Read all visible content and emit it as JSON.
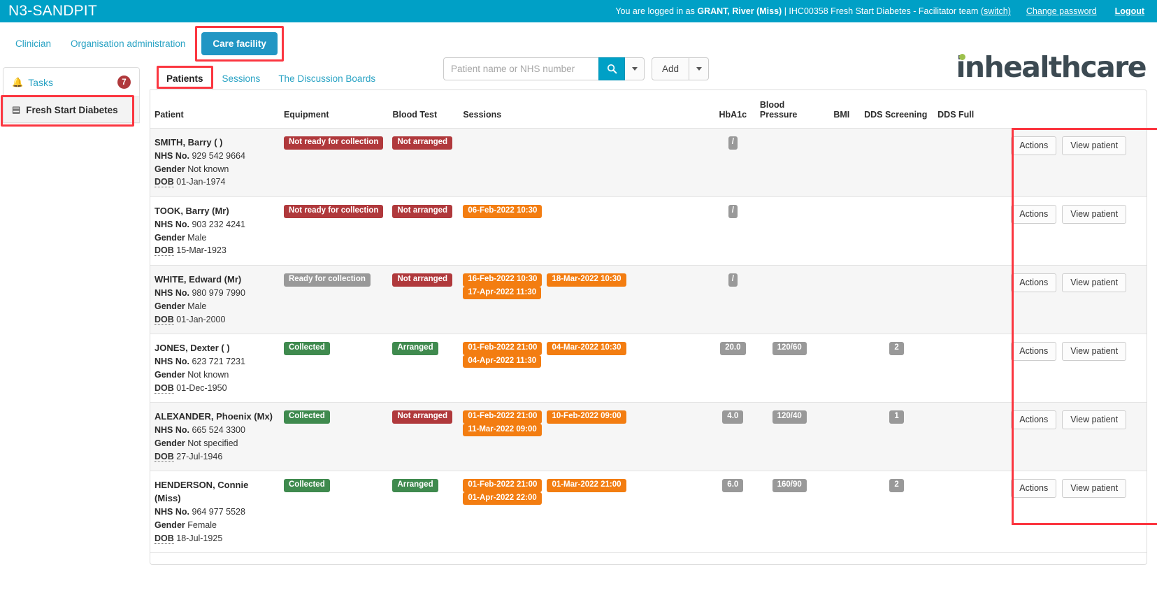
{
  "topbar": {
    "brand": "N3-SANDPIT",
    "logged_in_prefix": "You are logged in as ",
    "user_name": "GRANT, River (Miss)",
    "org_info": " | IHC00358 Fresh Start Diabetes - Facilitator team ",
    "switch_label": "(switch)",
    "change_password": "Change password",
    "logout": "Logout",
    "accent_color": "#00a0c6"
  },
  "nav": {
    "tabs": [
      {
        "label": "Clinician",
        "selected": false
      },
      {
        "label": "Organisation administration",
        "selected": false
      },
      {
        "label": "Care facility",
        "selected": true
      }
    ],
    "selected_color": "#2196c4",
    "highlight_color": "#fb3640"
  },
  "search": {
    "placeholder": "Patient name or NHS number",
    "value": "",
    "search_icon": "search-icon",
    "dropdown_icon": "chevron-down-icon",
    "add_label": "Add"
  },
  "logo": {
    "text": "inhealthcare",
    "dot_color": "#9cc04b",
    "text_color": "#3c4a52"
  },
  "sidebar": {
    "tasks": {
      "label": "Tasks",
      "icon": "bell-icon",
      "badge": "7",
      "badge_color": "#b0393c"
    },
    "items": [
      {
        "label": "Fresh Start Diabetes",
        "icon": "list-icon",
        "selected": true
      }
    ]
  },
  "subtabs": [
    {
      "label": "Patients",
      "selected": true
    },
    {
      "label": "Sessions",
      "selected": false
    },
    {
      "label": "The Discussion Boards",
      "selected": false
    }
  ],
  "table": {
    "columns": [
      "Patient",
      "Equipment",
      "Blood Test",
      "Sessions",
      "HbA1c",
      "Blood Pressure",
      "BMI",
      "DDS Screening",
      "DDS Full",
      ""
    ],
    "actions_label": "Actions",
    "view_label": "View patient",
    "rows": [
      {
        "name": "SMITH, Barry ( )",
        "nhs_label": "NHS No.",
        "nhs": "929 542 9664",
        "gender_label": "Gender",
        "gender": "Not known",
        "dob_label": "DOB",
        "dob": "01-Jan-1974",
        "equipment": {
          "text": "Not ready for collection",
          "color": "red"
        },
        "blood_test": {
          "text": "Not arranged",
          "color": "red"
        },
        "sessions": [],
        "hba1c": {
          "text": "/",
          "color": "grey"
        },
        "bp": null,
        "bmi": null,
        "dds_screening": null,
        "dds_full": null
      },
      {
        "name": "TOOK, Barry (Mr)",
        "nhs_label": "NHS No.",
        "nhs": "903 232 4241",
        "gender_label": "Gender",
        "gender": "Male",
        "dob_label": "DOB",
        "dob": "15-Mar-1923",
        "equipment": {
          "text": "Not ready for collection",
          "color": "red"
        },
        "blood_test": {
          "text": "Not arranged",
          "color": "red"
        },
        "sessions": [
          {
            "text": "06-Feb-2022 10:30",
            "color": "orange"
          }
        ],
        "hba1c": {
          "text": "/",
          "color": "grey"
        },
        "bp": null,
        "bmi": null,
        "dds_screening": null,
        "dds_full": null
      },
      {
        "name": "WHITE, Edward (Mr)",
        "nhs_label": "NHS No.",
        "nhs": "980 979 7990",
        "gender_label": "Gender",
        "gender": "Male",
        "dob_label": "DOB",
        "dob": "01-Jan-2000",
        "equipment": {
          "text": "Ready for collection",
          "color": "grey"
        },
        "blood_test": {
          "text": "Not arranged",
          "color": "red"
        },
        "sessions": [
          {
            "text": "16-Feb-2022 10:30",
            "color": "orange"
          },
          {
            "text": "18-Mar-2022 10:30",
            "color": "orange"
          },
          {
            "text": "17-Apr-2022 11:30",
            "color": "orange"
          }
        ],
        "hba1c": {
          "text": "/",
          "color": "grey"
        },
        "bp": null,
        "bmi": null,
        "dds_screening": null,
        "dds_full": null
      },
      {
        "name": "JONES, Dexter ( )",
        "nhs_label": "NHS No.",
        "nhs": "623 721 7231",
        "gender_label": "Gender",
        "gender": "Not known",
        "dob_label": "DOB",
        "dob": "01-Dec-1950",
        "equipment": {
          "text": "Collected",
          "color": "green"
        },
        "blood_test": {
          "text": "Arranged",
          "color": "green"
        },
        "sessions": [
          {
            "text": "01-Feb-2022 21:00",
            "color": "orange"
          },
          {
            "text": "04-Mar-2022 10:30",
            "color": "orange"
          },
          {
            "text": "04-Apr-2022 11:30",
            "color": "orange"
          }
        ],
        "hba1c": {
          "text": "20.0",
          "color": "grey"
        },
        "bp": {
          "text": "120/60",
          "color": "grey"
        },
        "bmi": null,
        "dds_screening": {
          "text": "2",
          "color": "grey"
        },
        "dds_full": null
      },
      {
        "name": "ALEXANDER, Phoenix (Mx)",
        "nhs_label": "NHS No.",
        "nhs": "665 524 3300",
        "gender_label": "Gender",
        "gender": "Not specified",
        "dob_label": "DOB",
        "dob": "27-Jul-1946",
        "equipment": {
          "text": "Collected",
          "color": "green"
        },
        "blood_test": {
          "text": "Not arranged",
          "color": "red"
        },
        "sessions": [
          {
            "text": "01-Feb-2022 21:00",
            "color": "orange"
          },
          {
            "text": "10-Feb-2022 09:00",
            "color": "orange"
          },
          {
            "text": "11-Mar-2022 09:00",
            "color": "orange"
          }
        ],
        "hba1c": {
          "text": "4.0",
          "color": "grey"
        },
        "bp": {
          "text": "120/40",
          "color": "grey"
        },
        "bmi": null,
        "dds_screening": {
          "text": "1",
          "color": "grey"
        },
        "dds_full": null
      },
      {
        "name": "HENDERSON, Connie (Miss)",
        "nhs_label": "NHS No.",
        "nhs": "964 977 5528",
        "gender_label": "Gender",
        "gender": "Female",
        "dob_label": "DOB",
        "dob": "18-Jul-1925",
        "equipment": {
          "text": "Collected",
          "color": "green"
        },
        "blood_test": {
          "text": "Arranged",
          "color": "green"
        },
        "sessions": [
          {
            "text": "01-Feb-2022 21:00",
            "color": "orange"
          },
          {
            "text": "01-Mar-2022 21:00",
            "color": "orange"
          },
          {
            "text": "01-Apr-2022 22:00",
            "color": "orange"
          }
        ],
        "hba1c": {
          "text": "6.0",
          "color": "grey"
        },
        "bp": {
          "text": "160/90",
          "color": "grey"
        },
        "bmi": null,
        "dds_screening": {
          "text": "2",
          "color": "grey"
        },
        "dds_full": null
      }
    ]
  }
}
